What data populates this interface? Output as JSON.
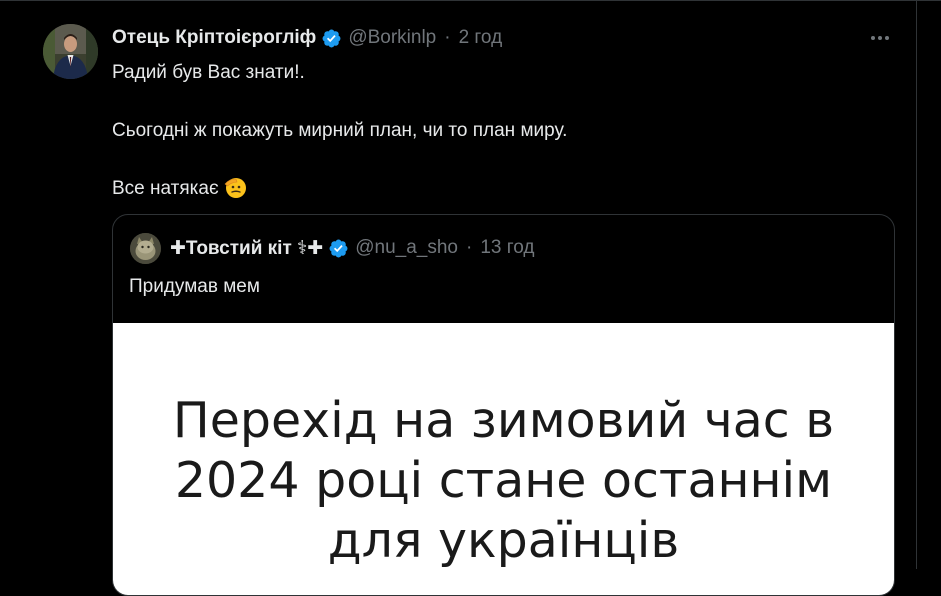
{
  "tweet": {
    "author": {
      "display_name": "Отець Кріптоієрогліф",
      "handle": "@Borkinlp",
      "verified": true
    },
    "separator": "·",
    "time": "2 год",
    "text_lines": [
      "Радий був Вас знати!.",
      "Сьогодні ж покажуть мирний план, чи то план миру.",
      "Все натякає"
    ],
    "emoji_icon": "saluting-face-emoji",
    "more_icon": "more-horizontal-icon"
  },
  "quote": {
    "author": {
      "display_name": "✚Товстий кіт ⚕✚",
      "handle": "@nu_a_sho",
      "verified": true
    },
    "separator": "·",
    "time": "13 год",
    "text": "Придумав мем",
    "meme": {
      "lines": [
        "Перехід на зимовий час в",
        "2024 році стане останнім",
        "для українців"
      ]
    }
  },
  "colors": {
    "background": "#000000",
    "text_primary": "#e7e9ea",
    "text_secondary": "#71767b",
    "border": "#2f3336",
    "verified_blue": "#1d9bf0"
  }
}
